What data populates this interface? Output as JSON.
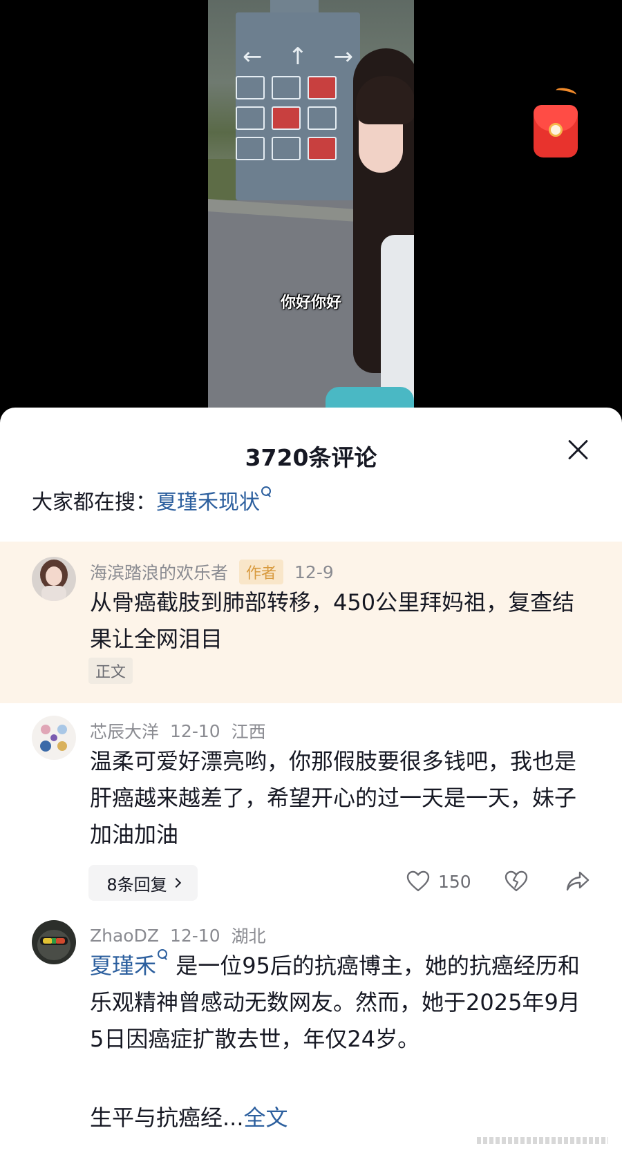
{
  "video": {
    "caption": "你好你好"
  },
  "panel": {
    "title": "3720条评论",
    "search_prefix": "大家都在搜：",
    "search_term": "夏瑾禾现状"
  },
  "pinned_comment": {
    "username": "海滨踏浪的欢乐者",
    "author_tag": "作者",
    "date": "12-9",
    "text": "从骨癌截肢到肺部转移，450公里拜妈祖，复查结果让全网泪目",
    "label": "正文"
  },
  "comments": [
    {
      "username": "芯辰大洋",
      "date": "12-10",
      "location": "江西",
      "text": "温柔可爱好漂亮哟，你那假肢要很多钱吧，我也是肝癌越来越差了，希望开心的过一天是一天，妹子加油加油",
      "replies_label": "8条回复",
      "likes": "150"
    },
    {
      "username": "ZhaoDZ",
      "date": "12-10",
      "location": "湖北",
      "mention": "夏瑾禾",
      "text": "是一位95后的抗癌博主，她的抗癌经历和乐观精神曾感动无数网友。然而，她于2025年9月5日因癌症扩散去世，年仅24岁。",
      "text2": "生平与抗癌经...",
      "more_label": "全文"
    }
  ],
  "colors": {
    "link": "#2c5f9e",
    "pinned_bg": "#fdf4e9",
    "author_tag": "#d89a3e",
    "redpacket": "#e8332d"
  },
  "icons": [
    "close-icon",
    "search-icon",
    "heart-icon",
    "dislike-icon",
    "share-icon",
    "red-packet-icon",
    "chevron-right-icon"
  ]
}
